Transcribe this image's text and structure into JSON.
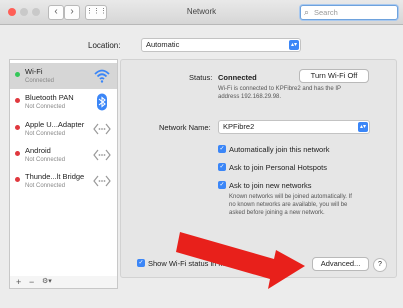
{
  "window": {
    "title": "Network",
    "search_placeholder": "Search"
  },
  "location": {
    "label": "Location:",
    "value": "Automatic"
  },
  "services": [
    {
      "name": "Wi-Fi",
      "status": "Connected",
      "color": "#34c759",
      "icon": "wifi-icon"
    },
    {
      "name": "Bluetooth PAN",
      "status": "Not Connected",
      "color": "#e0383e",
      "icon": "bluetooth-icon"
    },
    {
      "name": "Apple U...Adapter",
      "status": "Not Connected",
      "color": "#e0383e",
      "icon": "ethernet-icon"
    },
    {
      "name": "Android",
      "status": "Not Connected",
      "color": "#e0383e",
      "icon": "ethernet-icon"
    },
    {
      "name": "Thunde...lt Bridge",
      "status": "Not Connected",
      "color": "#e0383e",
      "icon": "ethernet-icon"
    }
  ],
  "sidebar_controls": {
    "add": "+",
    "remove": "−",
    "gear": "⚙▾"
  },
  "detail": {
    "status_label": "Status:",
    "status_value": "Connected",
    "turn_off_button": "Turn Wi-Fi Off",
    "status_desc_1": "Wi-Fi is connected to KPFibre2 and has the IP",
    "status_desc_2": "address 192.168.29.98.",
    "network_name_label": "Network Name:",
    "network_name_value": "KPFibre2",
    "checkbox_auto_join": "Automatically join this network",
    "checkbox_hotspots": "Ask to join Personal Hotspots",
    "checkbox_new_networks": "Ask to join new networks",
    "note_1": "Known networks will be joined automatically. If",
    "note_2": "no known networks are available, you will be",
    "note_3": "asked before joining a new network.",
    "show_status_checkbox": "Show Wi-Fi status in menu bar",
    "advanced_button": "Advanced...",
    "help_button": "?"
  },
  "colors": {
    "accent": "#3b86f7",
    "annotation_arrow": "#e8201b"
  }
}
